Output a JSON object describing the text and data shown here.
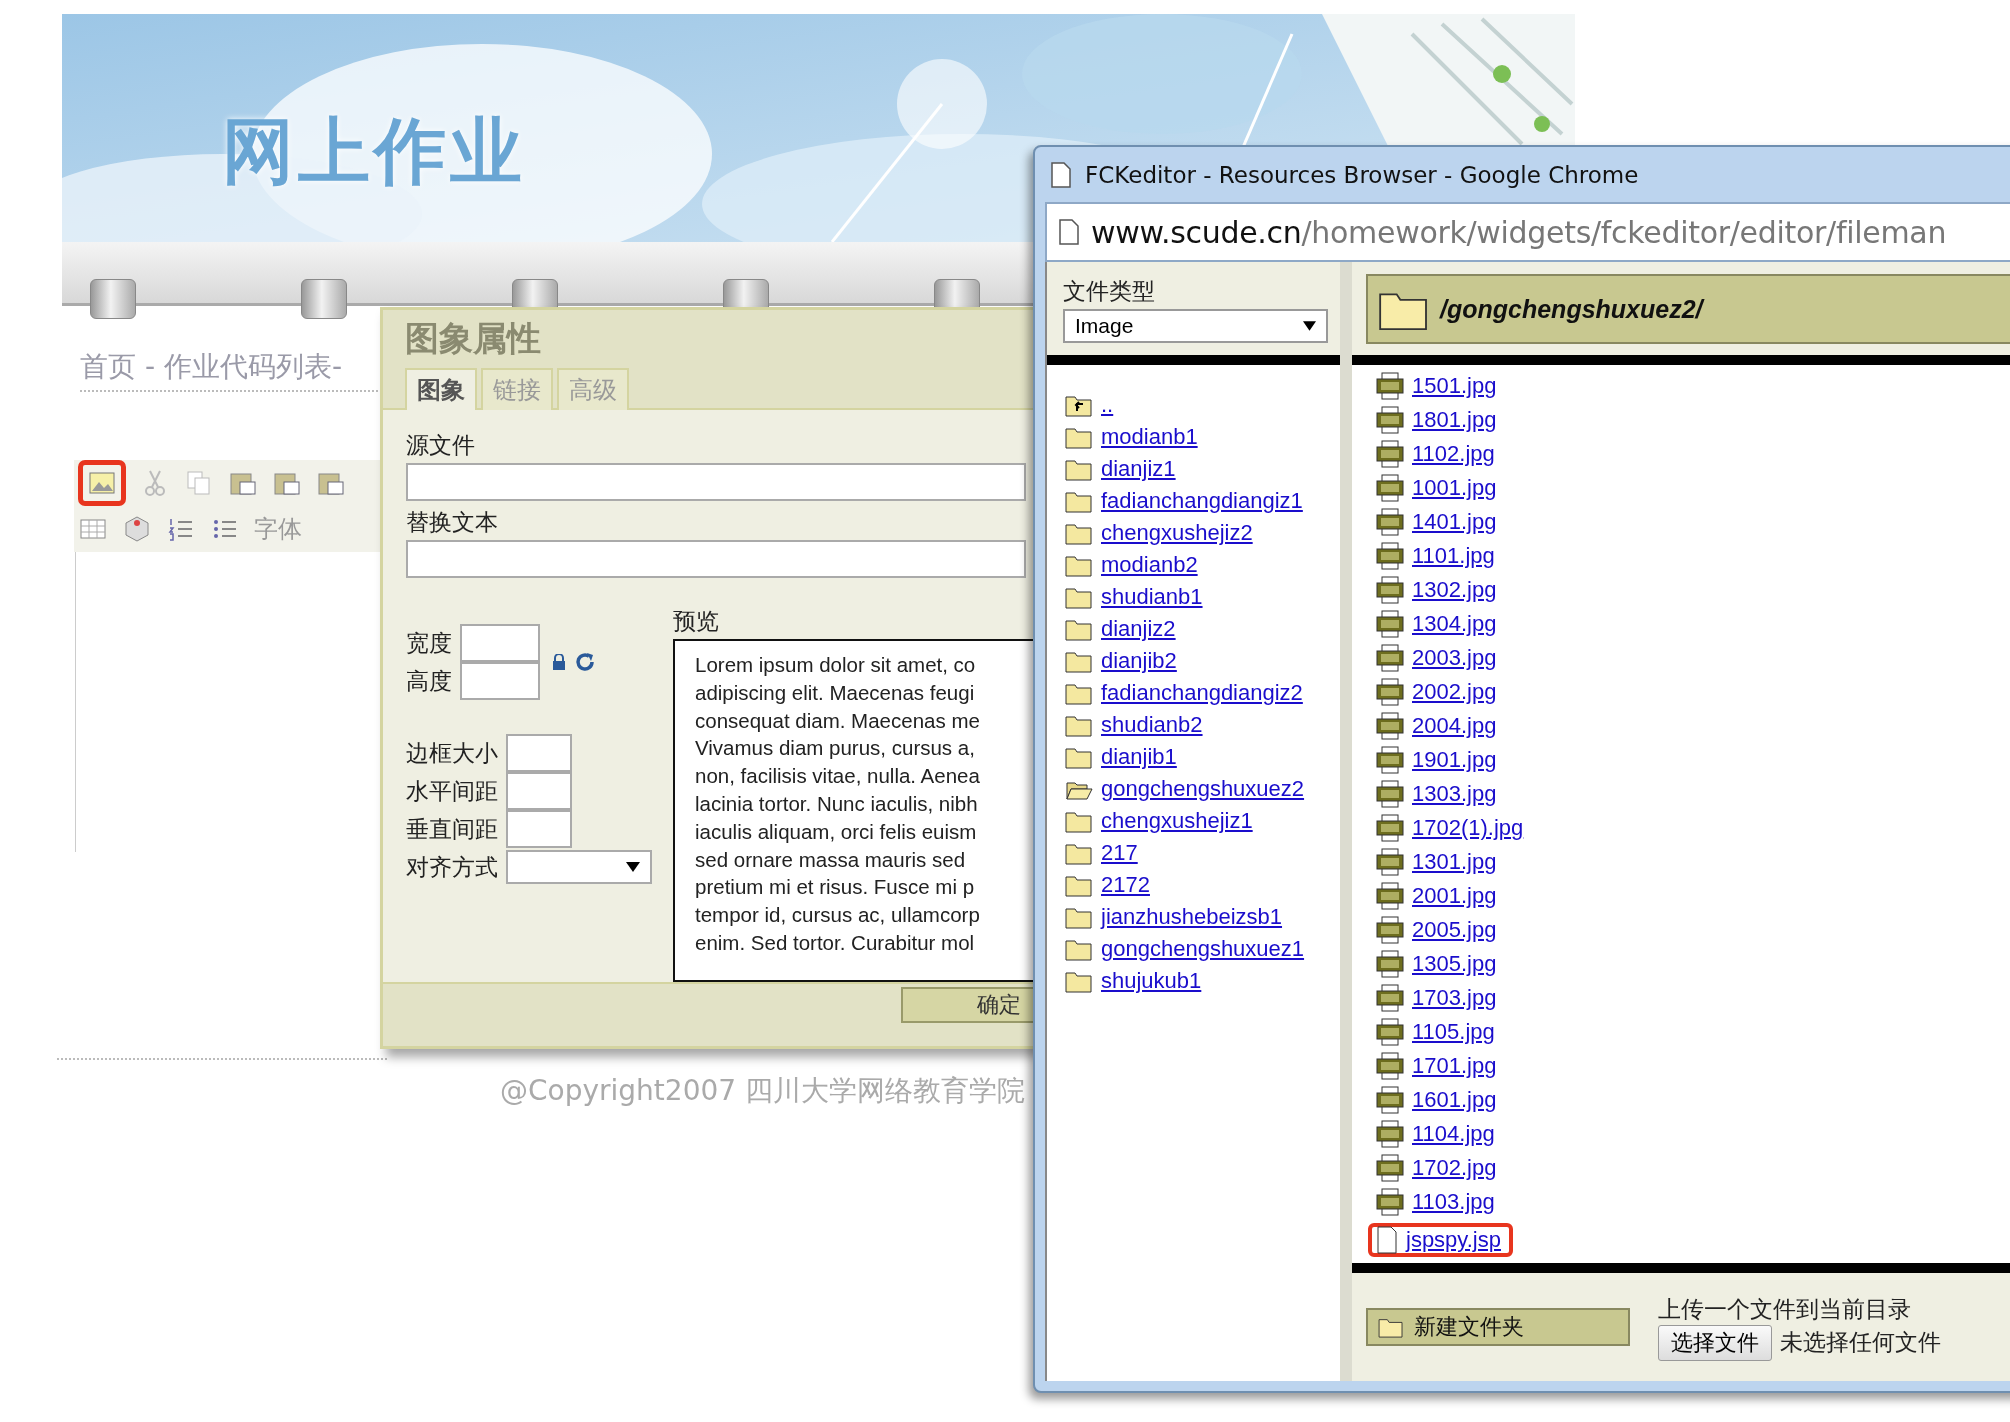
{
  "page": {
    "site_title": "网上作业",
    "breadcrumb": "首页 - 作业代码列表-",
    "toolbar": {
      "image_button_highlighted": true,
      "font_label": "字体"
    },
    "copyright": "@Copyright2007 四川大学网络教育学院"
  },
  "image_dialog": {
    "title": "图象属性",
    "tabs": [
      {
        "label": "图象",
        "selected": true
      },
      {
        "label": "链接",
        "selected": false
      },
      {
        "label": "高级",
        "selected": false
      }
    ],
    "source_label": "源文件",
    "alt_label": "替换文本",
    "width_label": "宽度",
    "height_label": "高度",
    "border_label": "边框大小",
    "hspace_label": "水平间距",
    "vspace_label": "垂直间距",
    "align_label": "对齐方式",
    "preview_label": "预览",
    "preview_lines": [
      "Lorem ipsum dolor sit amet, co",
      "adipiscing elit. Maecenas feugi",
      "consequat diam. Maecenas me",
      "Vivamus diam purus, cursus a,",
      "non, facilisis vitae, nulla. Aenea",
      "lacinia tortor. Nunc iaculis, nibh",
      "iaculis aliquam, orci felis euism",
      "sed ornare massa mauris sed",
      "pretium mi et risus. Fusce mi p",
      "tempor id, cursus ac, ullamcorp",
      "enim. Sed tortor. Curabitur mol"
    ],
    "ok_button": "确定"
  },
  "browser": {
    "title": "FCKeditor - Resources Browser - Google Chrome",
    "url_host": "www.scude.cn",
    "url_path": "/homework/widgets/fckeditor/editor/fileman",
    "file_type_label": "文件类型",
    "file_type_value": "Image",
    "current_path": "/gongchengshuxuez2/",
    "folders": [
      {
        "name": "..",
        "kind": "parent",
        "selected": false
      },
      {
        "name": "modianb1",
        "kind": "folder",
        "selected": false
      },
      {
        "name": "dianjiz1",
        "kind": "folder",
        "selected": false
      },
      {
        "name": "fadianchangdiangiz1",
        "kind": "folder",
        "selected": false
      },
      {
        "name": "chengxushejiz2",
        "kind": "folder",
        "selected": false
      },
      {
        "name": "modianb2",
        "kind": "folder",
        "selected": false
      },
      {
        "name": "shudianb1",
        "kind": "folder",
        "selected": false
      },
      {
        "name": "dianjiz2",
        "kind": "folder",
        "selected": false
      },
      {
        "name": "dianjib2",
        "kind": "folder",
        "selected": false
      },
      {
        "name": "fadianchangdiangiz2",
        "kind": "folder",
        "selected": false
      },
      {
        "name": "shudianb2",
        "kind": "folder",
        "selected": false
      },
      {
        "name": "dianjib1",
        "kind": "folder",
        "selected": false
      },
      {
        "name": "gongchengshuxuez2",
        "kind": "folder",
        "selected": true
      },
      {
        "name": "chengxushejiz1",
        "kind": "folder",
        "selected": false
      },
      {
        "name": "217",
        "kind": "folder",
        "selected": false
      },
      {
        "name": "2172",
        "kind": "folder",
        "selected": false
      },
      {
        "name": "jianzhushebeizsb1",
        "kind": "folder",
        "selected": false
      },
      {
        "name": "gongchengshuxuez1",
        "kind": "folder",
        "selected": false
      },
      {
        "name": "shujukub1",
        "kind": "folder",
        "selected": false
      }
    ],
    "files": [
      {
        "name": "1501.jpg",
        "kind": "jpg",
        "highlighted": false
      },
      {
        "name": "1801.jpg",
        "kind": "jpg",
        "highlighted": false
      },
      {
        "name": "1102.jpg",
        "kind": "jpg",
        "highlighted": false
      },
      {
        "name": "1001.jpg",
        "kind": "jpg",
        "highlighted": false
      },
      {
        "name": "1401.jpg",
        "kind": "jpg",
        "highlighted": false
      },
      {
        "name": "1101.jpg",
        "kind": "jpg",
        "highlighted": false
      },
      {
        "name": "1302.jpg",
        "kind": "jpg",
        "highlighted": false
      },
      {
        "name": "1304.jpg",
        "kind": "jpg",
        "highlighted": false
      },
      {
        "name": "2003.jpg",
        "kind": "jpg",
        "highlighted": false
      },
      {
        "name": "2002.jpg",
        "kind": "jpg",
        "highlighted": false
      },
      {
        "name": "2004.jpg",
        "kind": "jpg",
        "highlighted": false
      },
      {
        "name": "1901.jpg",
        "kind": "jpg",
        "highlighted": false
      },
      {
        "name": "1303.jpg",
        "kind": "jpg",
        "highlighted": false
      },
      {
        "name": "1702(1).jpg",
        "kind": "jpg",
        "highlighted": false
      },
      {
        "name": "1301.jpg",
        "kind": "jpg",
        "highlighted": false
      },
      {
        "name": "2001.jpg",
        "kind": "jpg",
        "highlighted": false
      },
      {
        "name": "2005.jpg",
        "kind": "jpg",
        "highlighted": false
      },
      {
        "name": "1305.jpg",
        "kind": "jpg",
        "highlighted": false
      },
      {
        "name": "1703.jpg",
        "kind": "jpg",
        "highlighted": false
      },
      {
        "name": "1105.jpg",
        "kind": "jpg",
        "highlighted": false
      },
      {
        "name": "1701.jpg",
        "kind": "jpg",
        "highlighted": false
      },
      {
        "name": "1601.jpg",
        "kind": "jpg",
        "highlighted": false
      },
      {
        "name": "1104.jpg",
        "kind": "jpg",
        "highlighted": false
      },
      {
        "name": "1702.jpg",
        "kind": "jpg",
        "highlighted": false
      },
      {
        "name": "1103.jpg",
        "kind": "jpg",
        "highlighted": false
      },
      {
        "name": "jspspy.jsp",
        "kind": "file",
        "highlighted": true
      }
    ],
    "new_folder_button": "新建文件夹",
    "upload_label": "上传一个文件到当前目录",
    "choose_file_button": "选择文件",
    "no_file_text": "未选择任何文件"
  }
}
